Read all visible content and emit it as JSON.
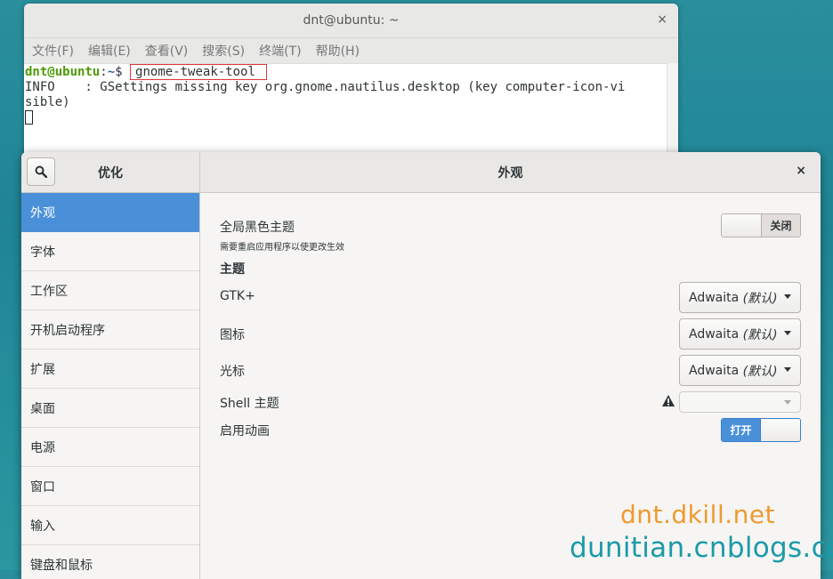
{
  "terminal": {
    "title": "dnt@ubuntu: ~",
    "close": "×",
    "menu": [
      "文件(F)",
      "编辑(E)",
      "查看(V)",
      "搜索(S)",
      "终端(T)",
      "帮助(H)"
    ],
    "prompt_user": "dnt@ubuntu",
    "prompt_sep": ":",
    "prompt_path": "~",
    "prompt_dollar": "$ ",
    "command": "gnome-tweak-tool",
    "output_line1": "INFO    : GSettings missing key org.gnome.nautilus.desktop (key computer-icon-vi",
    "output_line2": "sible)"
  },
  "tweak": {
    "sidebar_title": "优化",
    "page_title": "外观",
    "close": "×",
    "sidebar_items": [
      "外观",
      "字体",
      "工作区",
      "开机启动程序",
      "扩展",
      "桌面",
      "电源",
      "窗口",
      "输入",
      "键盘和鼠标"
    ],
    "active_index": 0,
    "dark_theme": {
      "label": "全局黑色主题",
      "sub": "需要重启应用程序以使更改生效",
      "state": "关闭"
    },
    "theme_section": "主题",
    "gtk": {
      "label": "GTK+",
      "value": "Adwaita",
      "suffix": "(默认)"
    },
    "icons": {
      "label": "图标",
      "value": "Adwaita",
      "suffix": "(默认)"
    },
    "cursor": {
      "label": "光标",
      "value": "Adwaita",
      "suffix": "(默认)"
    },
    "shell": {
      "label": "Shell 主题",
      "value": ""
    },
    "animations": {
      "label": "启用动画",
      "state": "打开"
    }
  },
  "watermark": {
    "line1": "dnt.dkill.net",
    "line2": "dunitian.cnblogs.com"
  }
}
